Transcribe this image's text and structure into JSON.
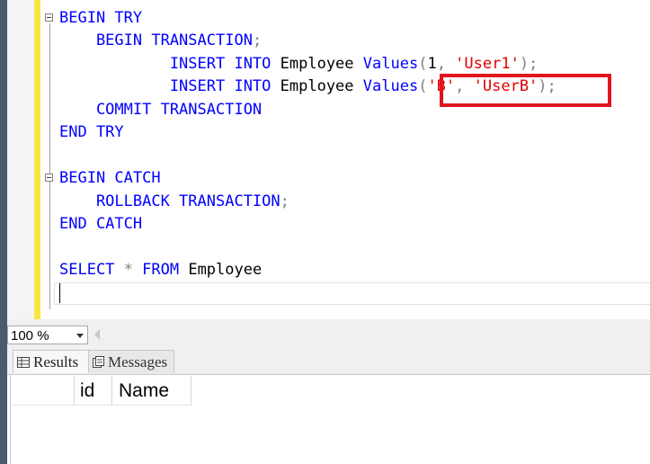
{
  "editor": {
    "lines": [
      [
        {
          "t": "BEGIN TRY",
          "c": "kw"
        }
      ],
      [
        {
          "t": "    BEGIN TRANSACTION",
          "c": "kw"
        },
        {
          "t": ";",
          "c": "gray"
        }
      ],
      [
        {
          "t": "            INSERT INTO ",
          "c": "kw"
        },
        {
          "t": "Employee ",
          "c": ""
        },
        {
          "t": "Values",
          "c": "kw"
        },
        {
          "t": "(",
          "c": "gray"
        },
        {
          "t": "1",
          "c": ""
        },
        {
          "t": ", ",
          "c": "gray"
        },
        {
          "t": "'User1'",
          "c": "str"
        },
        {
          "t": ");",
          "c": "gray"
        }
      ],
      [
        {
          "t": "            INSERT INTO ",
          "c": "kw"
        },
        {
          "t": "Employee ",
          "c": ""
        },
        {
          "t": "Values",
          "c": "kw"
        },
        {
          "t": "(",
          "c": "gray"
        },
        {
          "t": "'B'",
          "c": "str"
        },
        {
          "t": ", ",
          "c": "gray"
        },
        {
          "t": "'UserB'",
          "c": "str"
        },
        {
          "t": ");",
          "c": "gray"
        }
      ],
      [
        {
          "t": "    COMMIT TRANSACTION",
          "c": "kw"
        }
      ],
      [
        {
          "t": "END TRY",
          "c": "kw"
        }
      ],
      [],
      [
        {
          "t": "BEGIN CATCH",
          "c": "kw"
        }
      ],
      [
        {
          "t": "    ROLLBACK TRANSACTION",
          "c": "kw"
        },
        {
          "t": ";",
          "c": "gray"
        }
      ],
      [
        {
          "t": "END CATCH",
          "c": "kw"
        }
      ],
      [],
      [
        {
          "t": "SELECT ",
          "c": "kw"
        },
        {
          "t": "* ",
          "c": "gray"
        },
        {
          "t": "FROM ",
          "c": "kw"
        },
        {
          "t": "Employee",
          "c": ""
        }
      ],
      []
    ]
  },
  "zoom": {
    "value": "100 %"
  },
  "tabs": {
    "results": "Results",
    "messages": "Messages"
  },
  "grid": {
    "col_id": "id",
    "col_name": "Name"
  },
  "colors": {
    "keyword": "#0000ff",
    "string": "#e00000",
    "highlight": "#e0141e",
    "margin": "#f7e641"
  }
}
